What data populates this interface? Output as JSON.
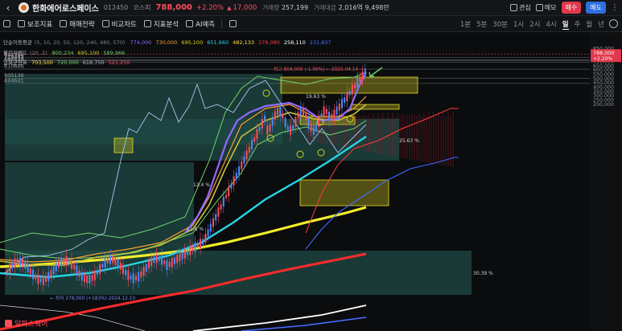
{
  "header": {
    "stock_name": "한화에어로스페이스",
    "code": "012450",
    "market": "코스피",
    "price": "788,000",
    "change_pct": "+2.20%",
    "change_abs": "17,000",
    "volume_label": "거래량",
    "volume": "257,199",
    "amount_label": "거래대금",
    "amount": "2,016억 9,498만",
    "interest_label": "관심",
    "memo_label": "메모",
    "buy_label": "매수",
    "sell_label": "매도"
  },
  "toolbar": {
    "indicator_label": "보조지표",
    "strategy_label": "매매전략",
    "compare_label": "비교차트",
    "drawing_label": "지표분석",
    "ai_label": "AI예측",
    "periods": [
      "1분",
      "5분",
      "30분",
      "1시",
      "2시",
      "4시",
      "일",
      "주",
      "월",
      "년"
    ],
    "active_period": "일"
  },
  "legends": {
    "ma": {
      "name": "단순이동평균",
      "params": "(5, 10, 20, 50, 120, 240, 480, 570)",
      "values": [
        "774,000",
        "730,000",
        "695,100",
        "651,660",
        "482,133",
        "378,080",
        "258,110",
        "231,837"
      ],
      "colors": [
        "#8f6cff",
        "#ff9f2e",
        "#d6d31f",
        "#25d6e6",
        "#ffe135",
        "#ff3b3b",
        "#ffffff",
        "#4a6cff"
      ]
    },
    "bb": {
      "name": "볼린저밴드",
      "params": "(20, 2)",
      "values": [
        "800,234",
        "695,100",
        "589,966"
      ],
      "colors": [
        "#6fd56a",
        "#d6d31f",
        "#6fd56a"
      ]
    },
    "ichimoku": {
      "name": "일목균형표",
      "values": [
        "703,500",
        "720,000",
        "618,750",
        "521,250"
      ],
      "colors": [
        "#ffe135",
        "#6fd56a",
        "#b7bbc1",
        "#ff4d5e"
      ]
    }
  },
  "price_axis": {
    "ticks": [
      "850,000",
      "800,000",
      "750,000",
      "700,000",
      "650,000",
      "600,000",
      "550,000",
      "500,000",
      "450,000",
      "400,000",
      "350,000",
      "300,000",
      "250,000",
      "200,000"
    ],
    "current_price": "788,000",
    "current_change": "+2.20%"
  },
  "levels": [
    "744796",
    "719202",
    "712073",
    "692829",
    "610666",
    "505136",
    "444641"
  ],
  "annotations": {
    "high_label": "최고 804,000 (-1.99%) ← 2025.04.14 →",
    "low_label": "← 최저 278,000 (+183%) 2024.12.10",
    "pct_1963": "19.63 %",
    "pct_2563": "25.63 %",
    "pct_124": "12.4 %",
    "pct_116": "11.6 %",
    "pct_3039": "30.39 %"
  },
  "watermark": "알파스퀘어"
}
